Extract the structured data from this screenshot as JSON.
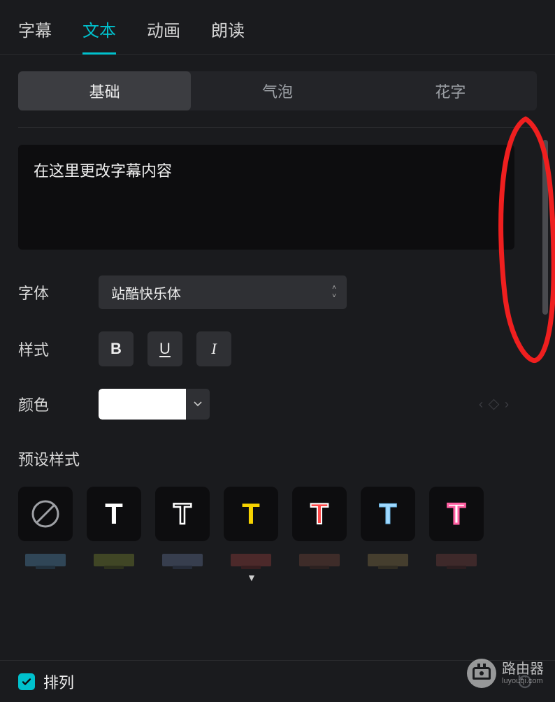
{
  "top_tabs": [
    "字幕",
    "文本",
    "动画",
    "朗读"
  ],
  "top_tab_active": 1,
  "sub_tabs": [
    "基础",
    "气泡",
    "花字"
  ],
  "sub_tab_active": 0,
  "caption_text": "在这里更改字幕内容",
  "labels": {
    "font": "字体",
    "style": "样式",
    "color": "颜色",
    "presets": "预设样式",
    "arrange": "排列"
  },
  "font": {
    "selected": "站酷快乐体"
  },
  "style_icons": {
    "bold": "B",
    "underline": "U",
    "italic": "I"
  },
  "color": {
    "value": "#ffffff"
  },
  "watermark": {
    "title": "路由器",
    "sub": "luyouqi.com"
  }
}
